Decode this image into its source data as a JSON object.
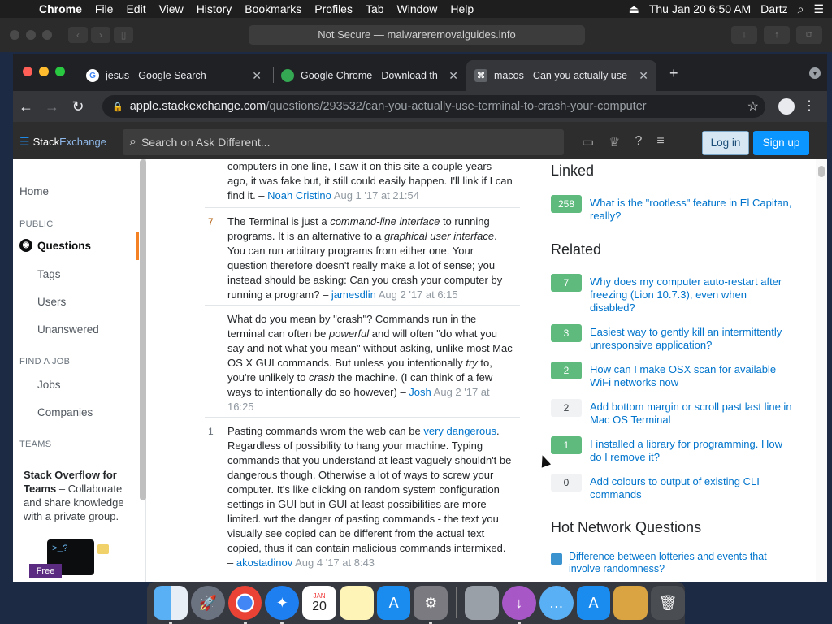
{
  "menubar": {
    "app_name": "Chrome",
    "items": [
      "File",
      "Edit",
      "View",
      "History",
      "Bookmarks",
      "Profiles",
      "Tab",
      "Window",
      "Help"
    ],
    "datetime": "Thu Jan 20  6:50 AM",
    "user": "Dartz"
  },
  "outer_window": {
    "address": "Not Secure — malwareremovalguides.info"
  },
  "tabs": [
    {
      "title": "jesus - Google Search",
      "favicon": "G",
      "favicon_color": "#4285f4"
    },
    {
      "title": "Google Chrome - Download th",
      "favicon": "●",
      "favicon_color": "#34a853"
    },
    {
      "title": "macos - Can you actually use T",
      "favicon": "⌘",
      "favicon_color": "#5f6368"
    }
  ],
  "omnibox": {
    "host": "apple.stackexchange.com",
    "path": "/questions/293532/can-you-actually-use-terminal-to-crash-your-computer"
  },
  "se_header": {
    "logo_stack": "Stack",
    "logo_exchange": "Exchange",
    "search_placeholder": "Search on Ask Different...",
    "login": "Log in",
    "signup": "Sign up"
  },
  "leftnav": {
    "home": "Home",
    "public": "PUBLIC",
    "questions": "Questions",
    "tags": "Tags",
    "users": "Users",
    "unanswered": "Unanswered",
    "find_a_job": "FIND A JOB",
    "jobs": "Jobs",
    "companies": "Companies",
    "teams": "TEAMS",
    "teams_title": "Stack Overflow for Teams",
    "teams_text": " – Collaborate and share knowledge with a private group.",
    "terminal_prompt": ">_?",
    "free_badge": "Free"
  },
  "comments": [
    {
      "score": "",
      "text": "computers in one line, I saw it on this site a couple years ago, it was fake but, it still could easily happen. I'll link if I can find it. – ",
      "user": "Noah Cristino",
      "date": "Aug 1 '17 at 21:54"
    },
    {
      "score": "7",
      "text_html_parts": [
        "The Terminal is just a ",
        "command-line interface",
        " to running programs. It is an alternative to a ",
        "graphical user interface",
        ". You can run arbitrary programs from either one. Your question therefore doesn't really make a lot of sense; you instead should be asking: Can you crash your computer by running a program? – "
      ],
      "user": "jamesdlin",
      "date": "Aug 2 '17 at 6:15"
    },
    {
      "score": "",
      "text_html_parts": [
        "What do you mean by \"crash\"? Commands run in the terminal can often be ",
        "powerful",
        " and will often \"do what you say and not what you mean\" without asking, unlike most Mac OS X GUI commands. But unless you intentionally ",
        "try",
        " to, you're unlikely to ",
        "crash",
        " the machine. (I can think of a few ways to intentionally do so however) – "
      ],
      "user": "Josh",
      "date": "Aug 2 '17 at 16:25"
    },
    {
      "score": "1",
      "text_before_link": "Pasting commands wrom the web can be ",
      "link": "very dangerous",
      "text_after_link": ". Regardless of possibility to hang your machine. Typing commands that you understand at least vaguely shouldn't be dangerous though. Otherwise a lot of ways to screw your computer. It's like clicking on random system configuration settings in GUI but in GUI at least possibilities are more limited. wrt the danger of pasting commands - the text you visually see copied can be different from the actual text copied, thus it can contain malicious commands intermixed. – ",
      "user": "akostadinov",
      "date": "Aug 4 '17 at 8:43"
    }
  ],
  "sidebar": {
    "linked_title": "Linked",
    "linked": [
      {
        "score": "258",
        "title": "What is the \"rootless\" feature in El Capitan, really?",
        "answered": true
      }
    ],
    "related_title": "Related",
    "related": [
      {
        "score": "7",
        "title": "Why does my computer auto-restart after freezing (Lion 10.7.3), even when disabled?",
        "answered": true
      },
      {
        "score": "3",
        "title": "Easiest way to gently kill an intermittently unresponsive application?",
        "answered": true
      },
      {
        "score": "2",
        "title": "How can I make OSX scan for available WiFi networks now",
        "answered": true
      },
      {
        "score": "2",
        "title": "Add bottom margin or scroll past last line in Mac OS Terminal",
        "answered": false
      },
      {
        "score": "1",
        "title": "I installed a library for programming. How do I remove it?",
        "answered": true
      },
      {
        "score": "0",
        "title": "Add colours to output of existing CLI commands",
        "answered": false
      }
    ],
    "hnq_title": "Hot Network Questions",
    "hnq": [
      {
        "title": "Difference between lotteries and events that involve randomness?"
      }
    ]
  },
  "dock": {
    "calendar_month": "JAN",
    "calendar_day": "20",
    "icons": [
      "finder-icon",
      "launchpad-icon",
      "chrome-icon",
      "safari-icon",
      "calendar-icon",
      "notes-icon",
      "app-store-icon",
      "system-preferences-icon",
      "installer-icon",
      "downloads-icon",
      "messages-icon",
      "app-store-2-icon",
      "archive-icon",
      "trash-icon"
    ]
  },
  "colors": {
    "accent_orange": "#f48225",
    "link_blue": "#0074cc",
    "answered_green": "#5eba7d",
    "signup_blue": "#0a95ff"
  }
}
